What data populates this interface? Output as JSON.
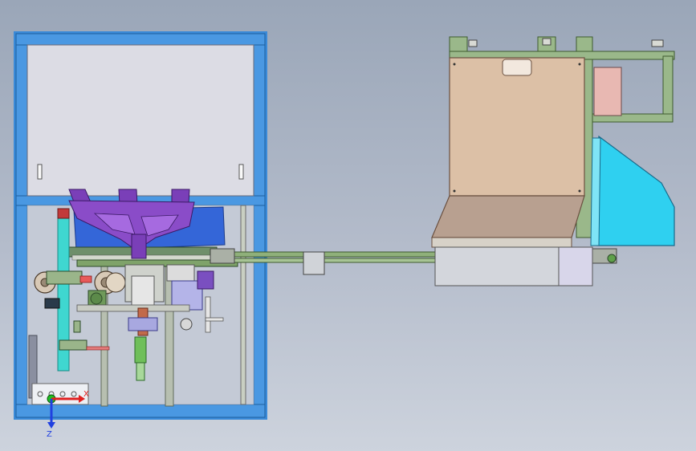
{
  "scene": {
    "kind": "CAD assembly view",
    "background_top": "#9aa6b8",
    "background_bottom": "#cdd3dd"
  },
  "colors": {
    "frame_blue": "#3a8ad8",
    "panel_gray": "#dcdce4",
    "chute_purple": "#7a3fb8",
    "hopper_tan": "#d8bfa8",
    "cover_cyan": "#2fd0f0",
    "rail_green": "#8fb07a",
    "tube_cyan": "#3fd7d0"
  },
  "triad": {
    "x_label": "X",
    "z_label": "Z",
    "x_color": "#e02020",
    "y_color": "#20c020",
    "z_color": "#2040e0"
  }
}
